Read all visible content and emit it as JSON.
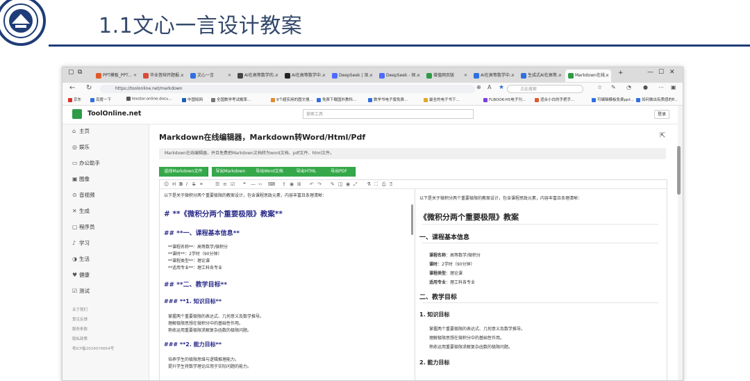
{
  "slide": {
    "title": "1.1文心一言设计教案"
  },
  "browser": {
    "tabs": [
      {
        "label": "PPT模板_PPT...",
        "color": "#e05a2b"
      },
      {
        "label": "毕业答辩开题报...",
        "color": "#d94b3a"
      },
      {
        "label": "文心一言",
        "color": "#2f6fe0"
      },
      {
        "label": "AI在高等数学的...",
        "color": "#444444"
      },
      {
        "label": "AI在高等数学中...",
        "color": "#222222"
      },
      {
        "label": "DeepSeek | 深...",
        "color": "#4d6bfe"
      },
      {
        "label": "DeepSeek - 探...",
        "color": "#4d6bfe"
      },
      {
        "label": "增值网页版",
        "color": "#2e9b46"
      },
      {
        "label": "AI在高等数学中...",
        "color": "#2f6fe0"
      },
      {
        "label": "生成式AI在高等...",
        "color": "#2f6fe0"
      },
      {
        "label": "Markdown在线...",
        "color": "#2e9b46"
      }
    ],
    "new_tab": "+",
    "url": "https://toolonline.net/markdown",
    "search_placeholder": "点此搜索",
    "bookmarks": [
      {
        "label": "京东",
        "color": "#d9302a"
      },
      {
        "label": "百度一下",
        "color": "#2f6fe0"
      },
      {
        "label": "texstor.online.docu...",
        "color": "#555555"
      },
      {
        "label": "中国知网",
        "color": "#1a5fb4"
      },
      {
        "label": "全国数学考试概率...",
        "color": "#777777"
      },
      {
        "label": "9个超实用的图文搜...",
        "color": "#e08a2b"
      },
      {
        "label": "免费下载国外教科...",
        "color": "#2f6fe0"
      },
      {
        "label": "数学书电子版免费...",
        "color": "#2f6fe0"
      },
      {
        "label": "最全的电子书下...",
        "color": "#e0a82b"
      },
      {
        "label": "FLBOOK-H5电子刊...",
        "color": "#7a3fe0"
      },
      {
        "label": "适合小白的手把手...",
        "color": "#e05a2b"
      },
      {
        "label": "可编辑模板免费ppt...",
        "color": "#2f6fe0"
      },
      {
        "label": "如何做出有质感的P...",
        "color": "#2f6fe0"
      }
    ]
  },
  "site": {
    "name": "ToolOnline.net",
    "search_placeholder": "搜索工具",
    "login": "登录",
    "sidebar": [
      {
        "icon": "⌂",
        "label": "主页"
      },
      {
        "icon": "◎",
        "label": "娱乐"
      },
      {
        "icon": "▭",
        "label": "办公助手"
      },
      {
        "icon": "▣",
        "label": "图像"
      },
      {
        "icon": "⊙",
        "label": "音视频"
      },
      {
        "icon": "✕",
        "label": "生成"
      },
      {
        "icon": "▢",
        "label": "程序员"
      },
      {
        "icon": "♪",
        "label": "学习"
      },
      {
        "icon": "◑",
        "label": "生活"
      },
      {
        "icon": "♥",
        "label": "健康"
      },
      {
        "icon": "☑",
        "label": "测试"
      }
    ],
    "footer_links": [
      "关于我们",
      "意见反馈",
      "服务条款",
      "隐私政策",
      "粤ICP备2024070654号"
    ]
  },
  "main": {
    "title": "Markdown在线编辑器，Markdown转Word/Html/Pdf",
    "description": "Markdown在线编辑器，并且免费把Markdown文档转为word文档、pdf文件、html文件。",
    "buttons": [
      "选择Markdown文件",
      "导出Markdown",
      "导出Word文档",
      "导出HTML",
      "导出PDF"
    ]
  },
  "editor": {
    "source": {
      "intro": "以下是关于微积分两个重要极限的教案设计，包含课程思政元素，内容丰富且条理清晰：",
      "h1": "# **《微积分两个重要极限》教案**",
      "h2_1": "## **一、课程基本信息**",
      "info": [
        "**课程名称**：高等数学/微积分",
        "**课时**：2学时（90分钟）",
        "**课程类型**：理论课",
        "**适用专业**：理工科各专业"
      ],
      "h2_2": "## **二、教学目标**",
      "h3_1": "### **1. 知识目标**",
      "knowledge": [
        "掌握两个重要极限的表达式、几何意义及数学推导。",
        "理解极限思想在微积分中的基础性作用。",
        "熟练运用重要极限求解复杂函数的极限问题。"
      ],
      "h3_2": "### **2. 能力目标**",
      "ability": [
        "培养学生的极限思维与逻辑推理能力。",
        "提升学生将数学理论应用于实际问题的能力。"
      ]
    },
    "preview": {
      "intro": "以下是关于微积分两个重要极限的教案设计，包含课程思政元素，内容丰富且条理清晰：",
      "h1": "《微积分两个重要极限》教案",
      "h2_1": "一、课程基本信息",
      "info": [
        {
          "k": "课程名称",
          "v": "：高等数学/微积分"
        },
        {
          "k": "课时",
          "v": "：2学时（90分钟）"
        },
        {
          "k": "课程类型",
          "v": "：理论课"
        },
        {
          "k": "适用专业",
          "v": "：理工科各专业"
        }
      ],
      "h2_2": "二、教学目标",
      "h3_1": "1. 知识目标",
      "knowledge": [
        "掌握两个重要极限的表达式、几何意义及数学推导。",
        "理解极限思想在微积分中的基础性作用。",
        "熟练运用重要极限求解复杂函数的极限问题。"
      ],
      "h3_2": "2. 能力目标"
    }
  }
}
